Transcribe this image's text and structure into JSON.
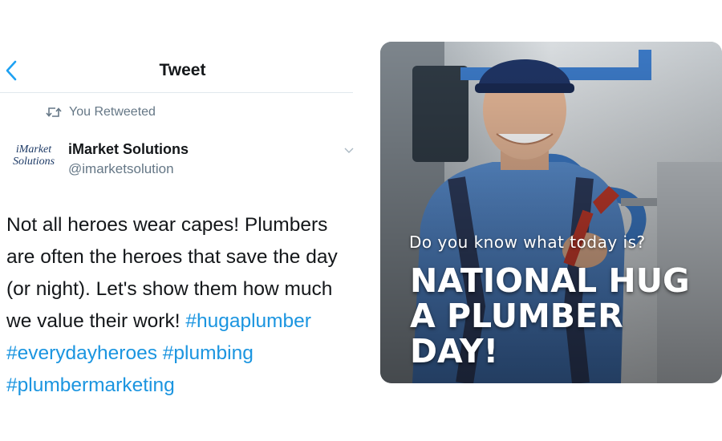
{
  "header": {
    "title": "Tweet"
  },
  "retweet": {
    "label": "You Retweeted"
  },
  "author": {
    "logo_line1": "iMarket",
    "logo_line2": "Solutions",
    "name": "iMarket Solutions",
    "handle": "@imarketsolution"
  },
  "tweet": {
    "text": "Not all heroes wear capes! Plumbers are often the heroes that save the day (or night). Let's show them how much we value their work!",
    "hashtags": [
      "#hugaplumber",
      "#everydayheroes",
      "#plumbing",
      "#plumbermarketing"
    ]
  },
  "media": {
    "question": "Do you know what today is?",
    "title_lines": [
      "NATIONAL HUG",
      "A PLUMBER",
      "DAY!"
    ]
  },
  "colors": {
    "link": "#1b95e0",
    "secondary_text": "#657786",
    "divider": "#e1e8ed"
  },
  "icons": [
    "back-chevron-icon",
    "retweet-icon",
    "chevron-down-icon"
  ]
}
